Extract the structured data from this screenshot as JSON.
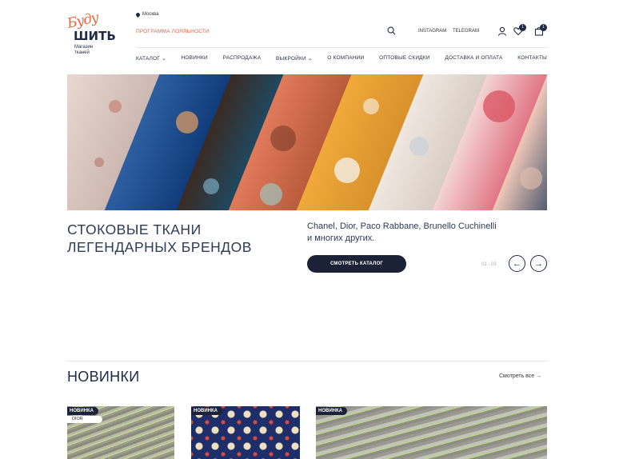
{
  "logo": {
    "script_text": "Буду",
    "main_text": "ШИТЬ",
    "sub_line1": "Магазин",
    "sub_line2": "тканей"
  },
  "header": {
    "city": "Москва",
    "loyalty": "ПРОГРАММА ЛОЯЛЬНОСТИ",
    "instagram": "INSTAGRAM",
    "telegram": "TELEGRAM",
    "wishlist_count": "1",
    "cart_count": "1"
  },
  "nav": {
    "items": [
      "КАТАЛОГ ⌄",
      "НОВИНКИ",
      "РАСПРОДАЖА",
      "ВЫКРОЙКИ ⌄",
      "О КОМПАНИИ",
      "ОПТОВЫЕ СКИДКИ",
      "ДОСТАВКА И ОПЛАТА",
      "КОНТАКТЫ"
    ]
  },
  "hero": {
    "title_line1": "СТОКОВЫЕ ТКАНИ",
    "title_line2": "ЛЕГЕНДАРНЫХ БРЕНДОВ",
    "desc_line1": "Chanel, Dior, Paco Rabbane, Brunello Cuchinelli",
    "desc_line2": "и многих других.",
    "cta": "СМОТРЕТЬ КАТАЛОГ",
    "counter": "01 - 03",
    "prev": "←",
    "next": "→"
  },
  "new_section": {
    "title": "НОВИНКИ",
    "see_all": "Смотреть все →",
    "cards": [
      {
        "tag": "НОВИНКА",
        "brand": "DIOR"
      },
      {
        "tag": "НОВИНКА",
        "brand": ""
      },
      {
        "tag": "НОВИНКА",
        "brand": ""
      }
    ]
  },
  "colors": {
    "accent": "#e8643a",
    "navy": "#1b2238"
  }
}
